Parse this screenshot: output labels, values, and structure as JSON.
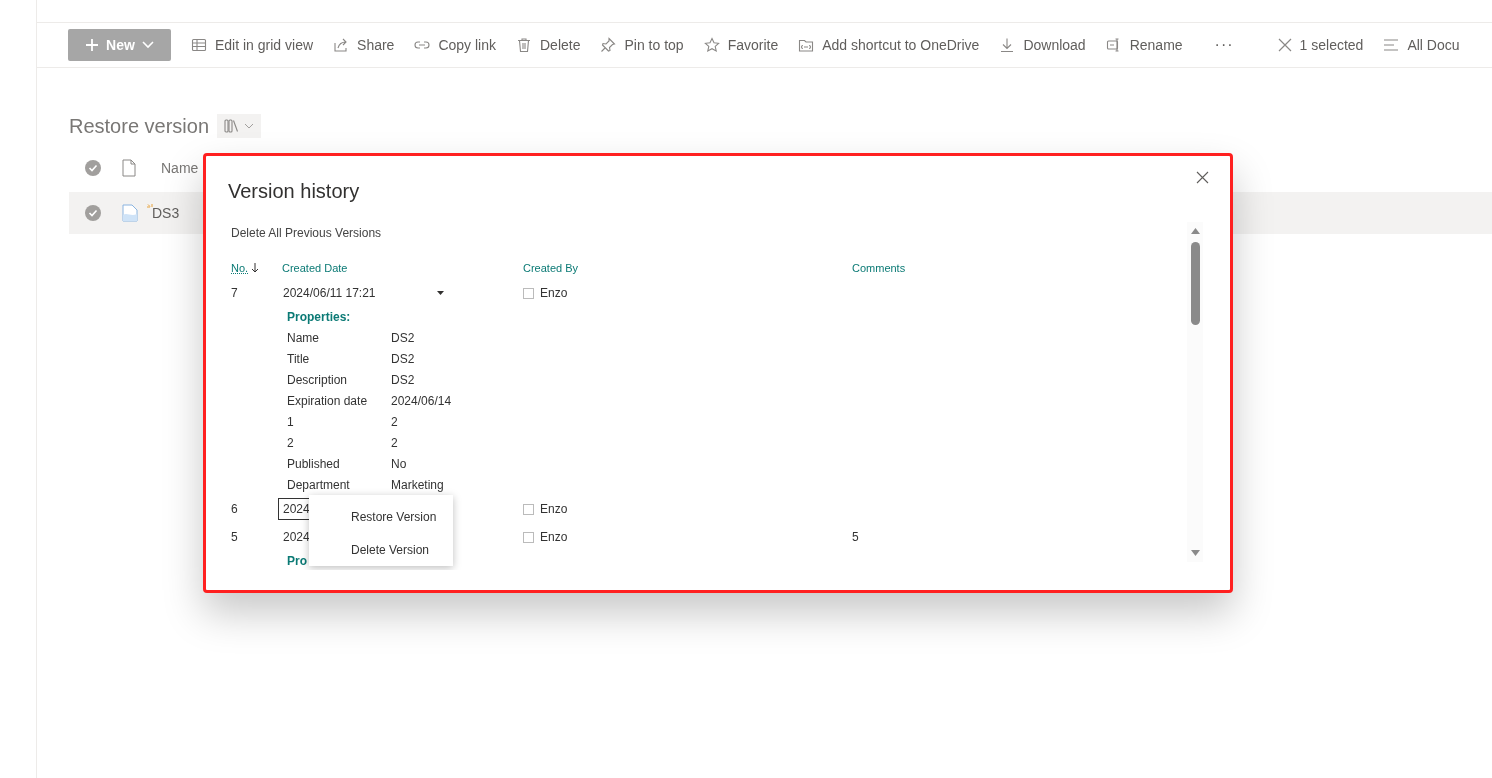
{
  "toolbar": {
    "new_button": "New",
    "commands": [
      {
        "label": "Edit in grid view"
      },
      {
        "label": "Share"
      },
      {
        "label": "Copy link"
      },
      {
        "label": "Delete"
      },
      {
        "label": "Pin to top"
      },
      {
        "label": "Favorite"
      },
      {
        "label": "Add shortcut to OneDrive"
      },
      {
        "label": "Download"
      },
      {
        "label": "Rename"
      }
    ],
    "more": "···",
    "selection": "1 selected",
    "view": "All Docu"
  },
  "library": {
    "title": "Restore version",
    "columns": [
      "Name"
    ],
    "rows": [
      {
        "name": "DS3",
        "selected": true
      }
    ]
  },
  "dialog": {
    "title": "Version history",
    "delete_all": "Delete All Previous Versions",
    "columns": [
      "No.",
      "Created Date",
      "Created By",
      "Comments"
    ],
    "versions": [
      {
        "no": "7",
        "date": "2024/06/11 17:21",
        "caret": true,
        "focused": false,
        "author": "Enzo",
        "checked": false,
        "properties_title": "Properties:",
        "properties": [
          {
            "label": "Name",
            "value": "DS2"
          },
          {
            "label": "Title",
            "value": "DS2"
          },
          {
            "label": "Description",
            "value": "DS2"
          },
          {
            "label": "Expiration date",
            "value": "2024/06/14"
          },
          {
            "label": "1",
            "value": "2"
          },
          {
            "label": "2",
            "value": "2"
          },
          {
            "label": "Published",
            "value": "No"
          },
          {
            "label": "Department",
            "value": "Marketing"
          }
        ]
      },
      {
        "no": "6",
        "date": "2024",
        "caret": false,
        "focused": true,
        "author": "Enzo",
        "checked": false
      },
      {
        "no": "5",
        "date": "2024",
        "caret": false,
        "focused": false,
        "author": "Enzo",
        "checked": false,
        "comment": "5",
        "properties_title": "Pro"
      }
    ],
    "menu": [
      "Restore Version",
      "Delete Version"
    ]
  }
}
